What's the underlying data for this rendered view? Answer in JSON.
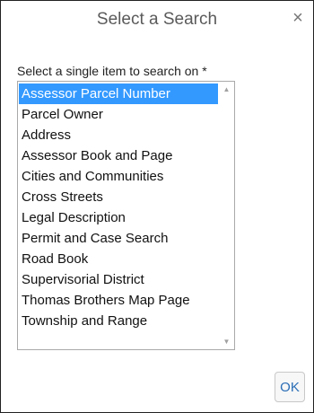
{
  "dialog": {
    "title": "Select a Search",
    "close_label": "×"
  },
  "form": {
    "label": "Select a single item to search on *",
    "options": [
      "Assessor Parcel Number",
      "Parcel Owner",
      "Address",
      "Assessor Book and Page",
      "Cities and Communities",
      "Cross Streets",
      "Legal Description",
      "Permit and Case Search",
      "Road Book",
      "Supervisorial District",
      "Thomas Brothers Map Page",
      "Township and Range"
    ],
    "selected_index": 0
  },
  "scrollbar": {
    "up_icon": "▲",
    "down_icon": "▼"
  },
  "footer": {
    "ok_label": "OK"
  },
  "colors": {
    "selection": "#3399ff",
    "ok_text": "#2a6db5"
  }
}
